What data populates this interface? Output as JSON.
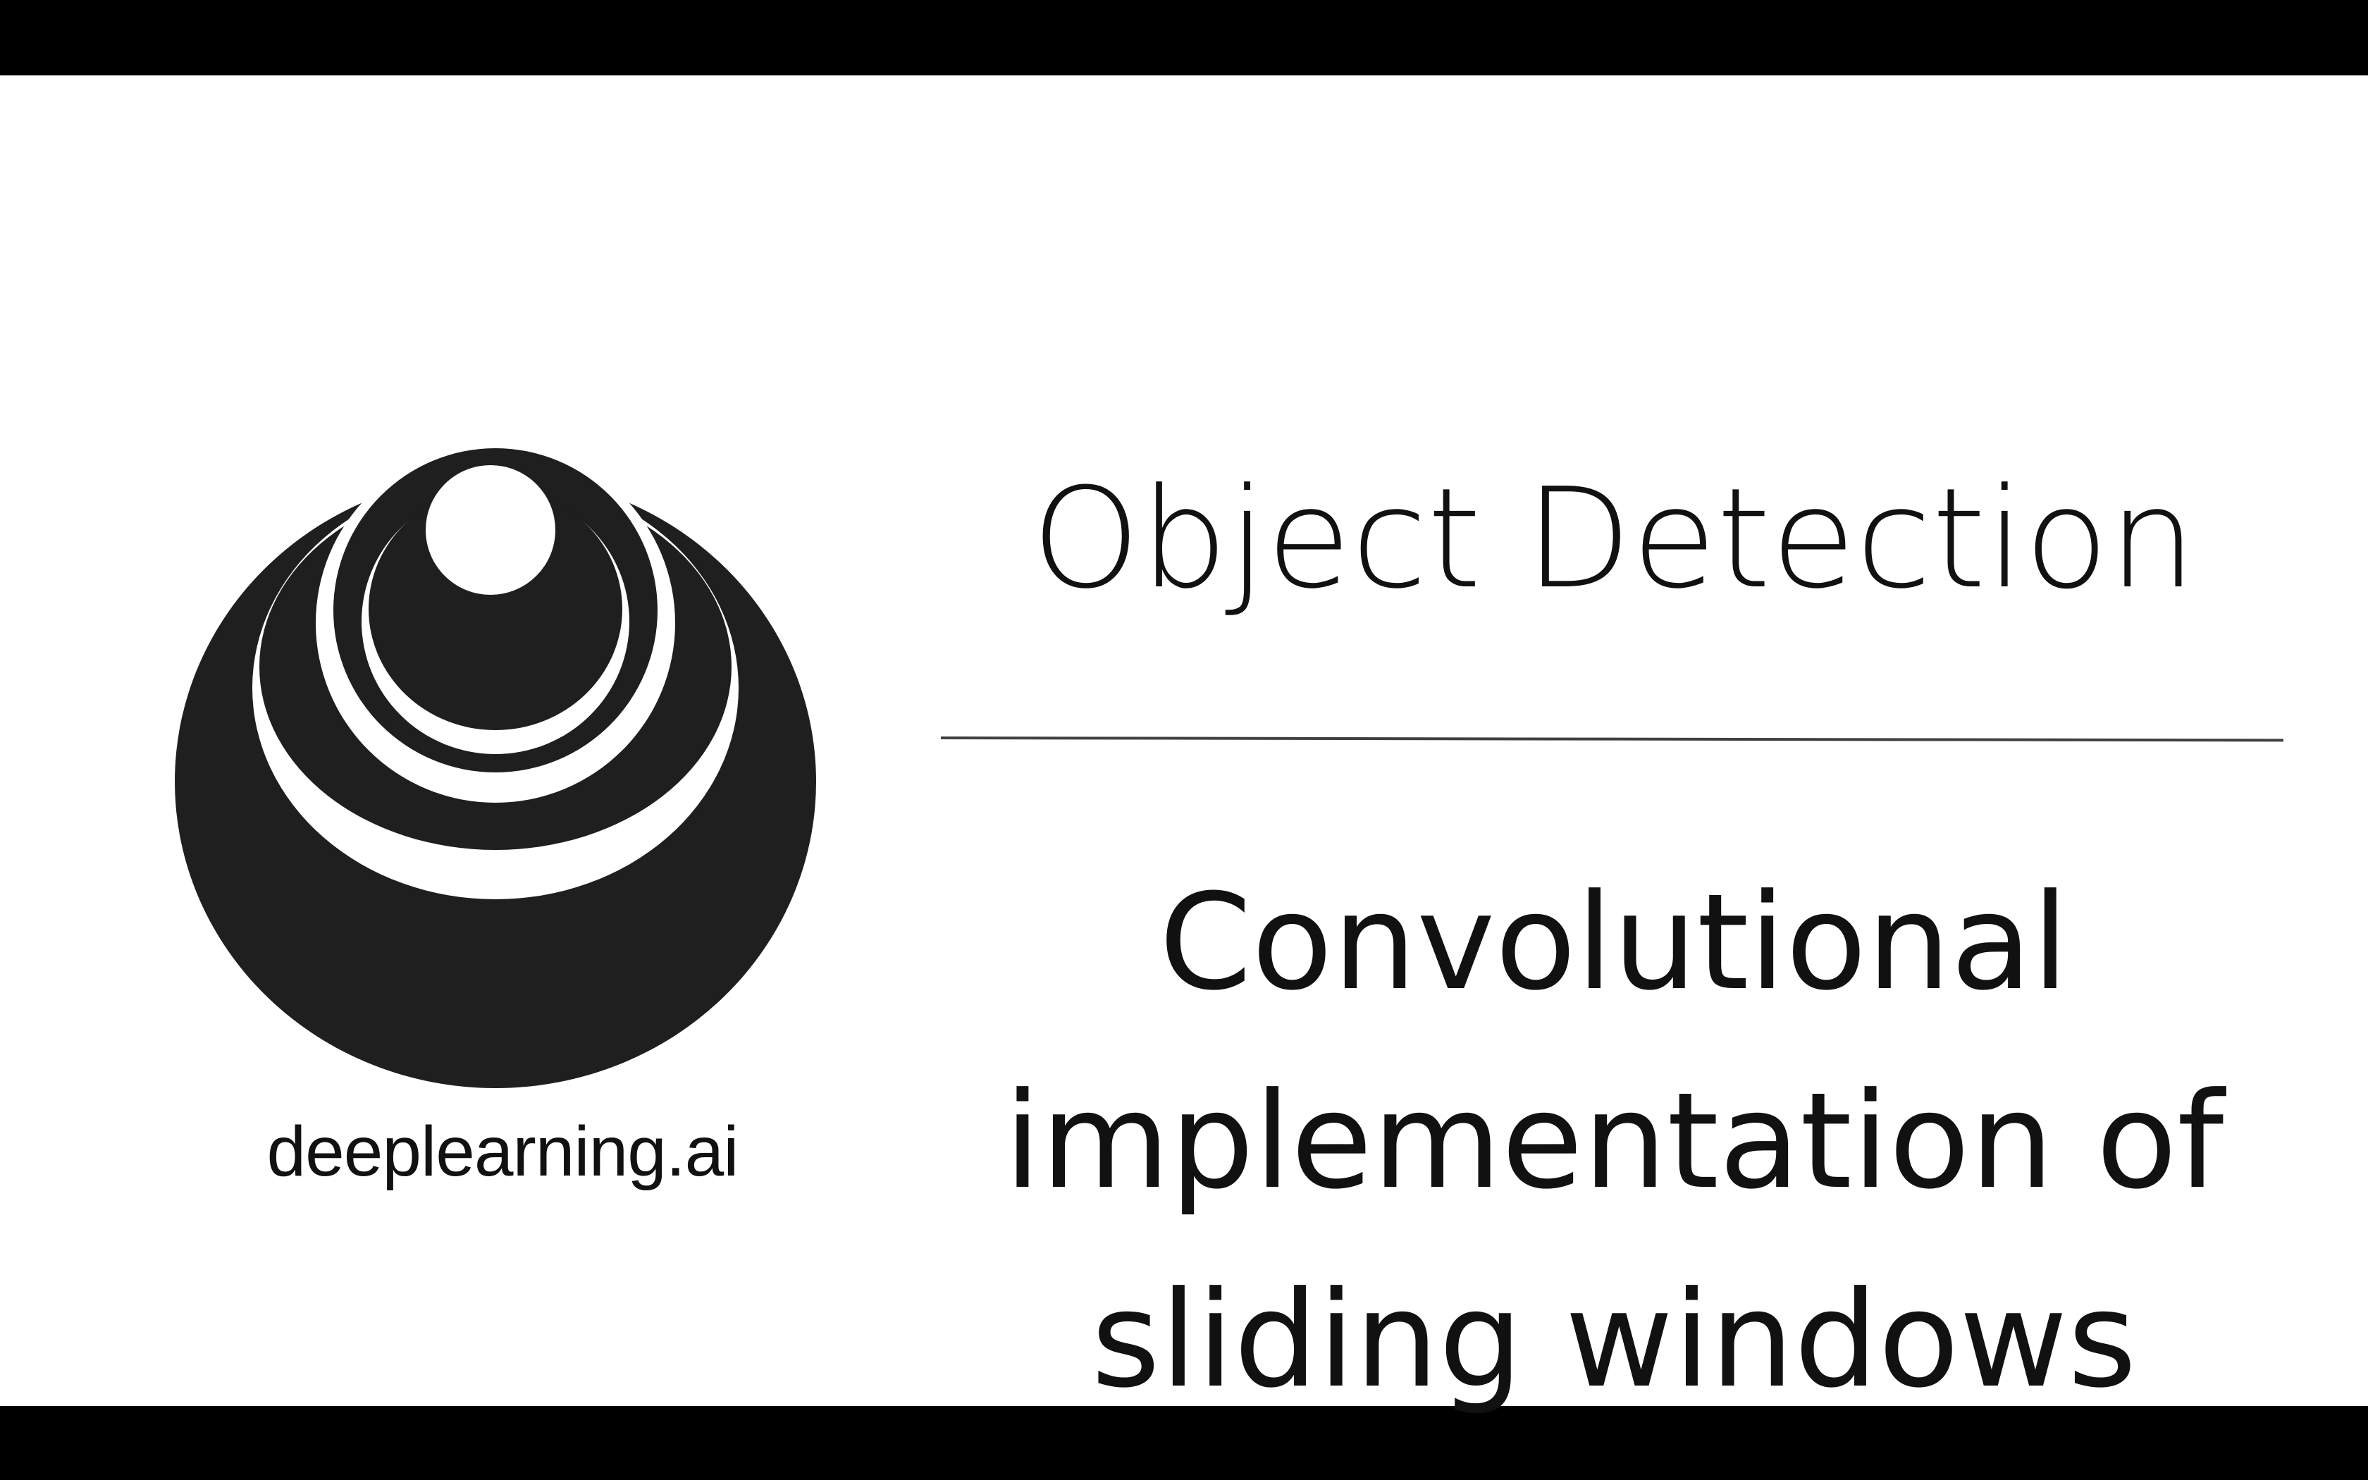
{
  "slide": {
    "logo": {
      "wordmark": "deeplearning.ai",
      "icon": "concentric-circles-logo-icon"
    },
    "title": "Object Detection",
    "subtitle_lines": [
      "Convolutional",
      "implementation of",
      "sliding windows"
    ]
  },
  "colors": {
    "letterbox": "#000000",
    "background": "#ffffff",
    "ink": "#111111",
    "logo_fill": "#1f1f1f",
    "divider": "#404040"
  }
}
